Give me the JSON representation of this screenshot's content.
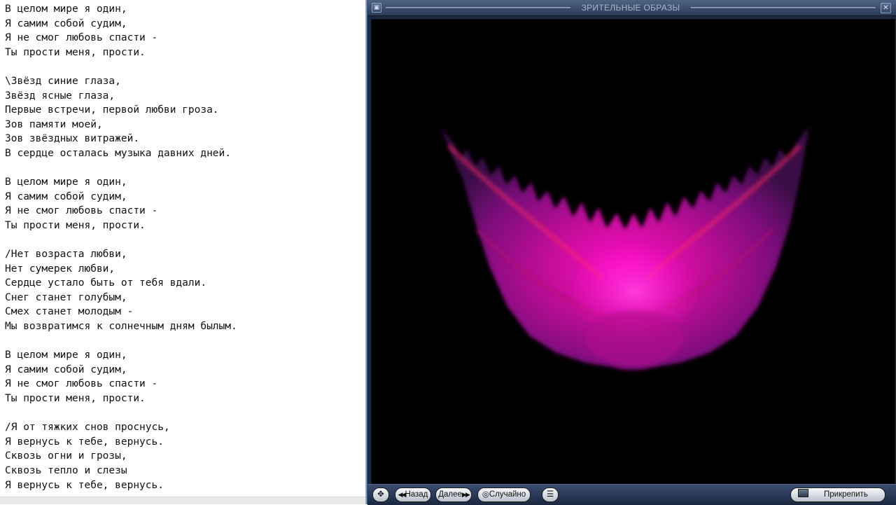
{
  "editor": {
    "lines": [
      "В целом мире я один,",
      "Я самим собой судим,",
      "Я не смог любовь спасти -",
      "Ты прости меня, прости.",
      "",
      "\\Звёзд синие глаза,",
      "Звёзд ясные глаза,",
      "Первые встречи, первой любви гроза.",
      "Зов памяти моей,",
      "Зов звёздных витражей.",
      "В сердце осталась музыка давних дней.",
      "",
      "В целом мире я один,",
      "Я самим собой судим,",
      "Я не смог любовь спасти -",
      "Ты прости меня, прости.",
      "",
      "/Нет возраста любви,",
      "Нет сумерек любви,",
      "Сердце устало быть от тебя вдали.",
      "Снег станет голубым,",
      "Смех станет молодым -",
      "Мы возвратимся к солнечным дням былым.",
      "",
      "В целом мире я один,",
      "Я самим собой судим,",
      "Я не смог любовь спасти -",
      "Ты прости меня, прости.",
      "",
      "/Я от тяжких снов проснусь,",
      "Я вернусь к тебе, вернусь.",
      "Сквозь огни и грозы,",
      "Сквозь тепло и слезы",
      "Я вернусь к тебе, вернусь."
    ]
  },
  "visualizer": {
    "title": "ЗРИТЕЛЬНЫЕ ОБРАЗЫ",
    "background_color": "#000000",
    "art_colors": {
      "core": "#ff10c8",
      "body": "#c8109c",
      "edge": "#7a0f7a",
      "vein": "#ff2a66"
    },
    "controls": {
      "back_label": "Назад",
      "next_label": "Далее",
      "random_label": "Случайно",
      "pin_label": "Прикрепить"
    }
  },
  "icons": [
    "move-icon",
    "back-arrows-icon",
    "next-arrows-icon",
    "random-icon",
    "menu-icon",
    "pin-icon",
    "system-menu-icon",
    "close-icon"
  ]
}
